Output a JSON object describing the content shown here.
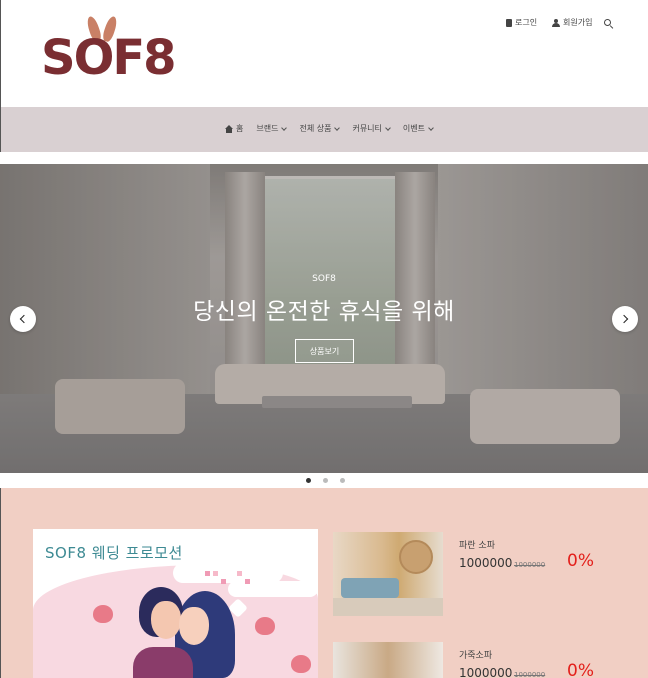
{
  "header": {
    "logo_text": "SOF8",
    "login_label": "로그인",
    "signup_label": "회원가입"
  },
  "nav": {
    "items": [
      {
        "label": "홈",
        "icon": "home-icon"
      },
      {
        "label": "브랜드",
        "icon": "chevron-down-icon"
      },
      {
        "label": "전체 상품",
        "icon": "chevron-down-icon"
      },
      {
        "label": "커뮤니티",
        "icon": "chevron-down-icon"
      },
      {
        "label": "이벤트",
        "icon": "chevron-down-icon"
      }
    ]
  },
  "hero": {
    "subtitle": "SOF8",
    "title": "당신의 온전한 휴식을 위해",
    "button_label": "상품보기",
    "slide_count": 3,
    "active_slide": 1
  },
  "promo": {
    "banner_title": "SOF8 웨딩 프로모션",
    "products": [
      {
        "name": "파란 소파",
        "price": "1000000",
        "original_price": "1000000",
        "discount": "0%"
      },
      {
        "name": "가죽소파",
        "price": "1000000",
        "original_price": "1000000",
        "discount": "0%"
      }
    ]
  },
  "colors": {
    "brand": "#7a2e32",
    "nav_bg": "#d9d0d2",
    "promo_bg": "#f1cfc4",
    "discount": "#e3201b",
    "banner_title": "#3d8a93"
  }
}
